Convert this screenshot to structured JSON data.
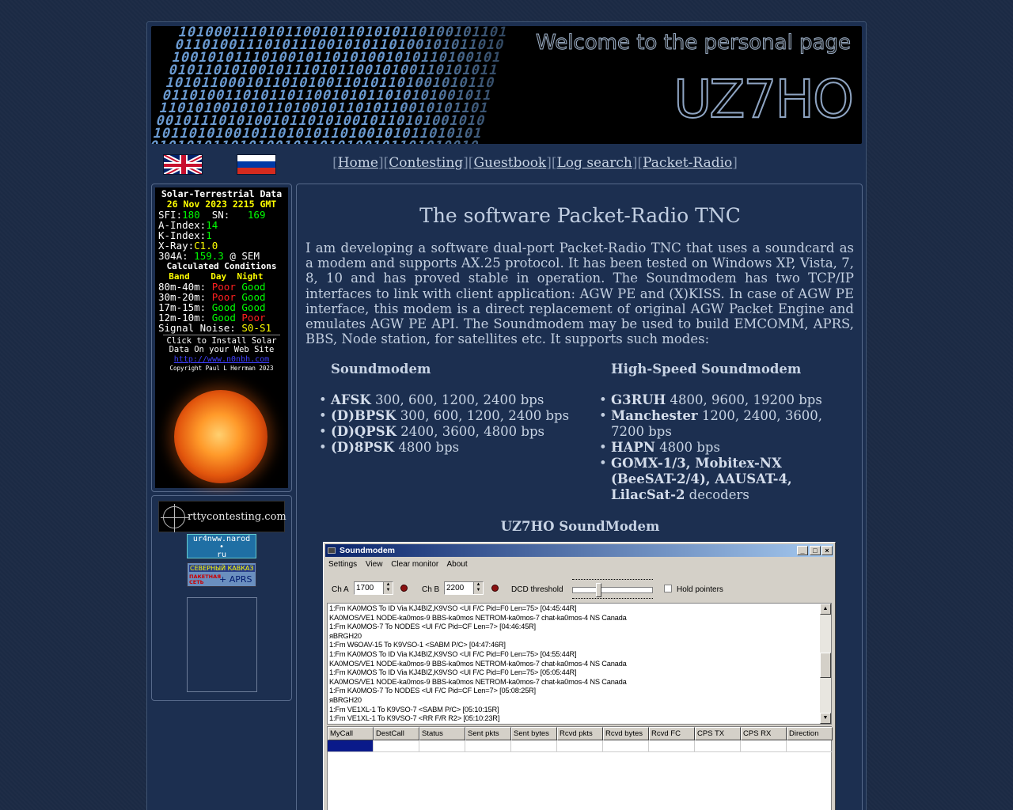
{
  "banner": {
    "welcome": "Welcome to the personal page",
    "callsign": "UZ7HO"
  },
  "nav": {
    "items": [
      "Home",
      "Contesting",
      "Guestbook",
      "Log search",
      "Packet-Radio"
    ]
  },
  "solar": {
    "title": "Solar-Terrestrial Data",
    "date": "26 Nov 2023 2215 GMT",
    "sfi_label": "SFI:",
    "sfi": "180",
    "sn_label": "SN:",
    "sn": "169",
    "aindex_label": "A-Index:",
    "aindex": "14",
    "kindex_label": "K-Index:",
    "kindex": "1",
    "xray_label": "X-Ray:",
    "xray": "C1.0",
    "a304_label": "304A:",
    "a304": "159.3",
    "a304_suffix": "@ SEM",
    "conditions_title": "Calculated Conditions",
    "col_band": "Band",
    "col_day": "Day",
    "col_night": "Night",
    "bands": [
      {
        "band": "80m-40m:",
        "day": "Poor",
        "night": "Good"
      },
      {
        "band": "30m-20m:",
        "day": "Poor",
        "night": "Good"
      },
      {
        "band": "17m-15m:",
        "day": "Good",
        "night": "Good"
      },
      {
        "band": "12m-10m:",
        "day": "Good",
        "night": "Poor"
      }
    ],
    "noise_label": "Signal Noise:",
    "noise": "S0-S1",
    "install1": "Click to Install Solar",
    "install2": "Data On your Web Site",
    "link": "http://www.n0nbh.com",
    "copyright": "Copyright Paul L Herrman 2023"
  },
  "links": {
    "rtty": "rttycontesting.com",
    "narod_line1": "ur4nww.narod",
    "narod_line2": "ru",
    "kavkaz_title": "СЕВЕРНЫЙ КАВКАЗ",
    "kavkaz_sub1": "ПАКЕТНАЯ",
    "kavkaz_sub2": "СЕТЬ",
    "kavkaz_aprs": "+ APRS"
  },
  "content": {
    "title": "The software Packet-Radio TNC",
    "intro": "I am developing a software dual-port Packet-Radio TNC that uses a soundcard as a modem and supports AX.25 protocol. It has been tested on Windows XP, Vista, 7, 8, 10 and has proved stable in operation. The Soundmodem has two TCP/IP interfaces to link with client application: AGW PE and (X)KISS. In case of AGW PE interface, this modem is a direct replacement of original AGW Packet Engine and emulates AGW PE API. The Soundmodem may be used to build EMCOMM, APRS, BBS, Node station, for satellites etc. It supports such modes:",
    "col1_title": "Soundmodem",
    "col1_items": [
      {
        "mode": "AFSK",
        "rates": " 300, 600, 1200, 2400 bps"
      },
      {
        "mode": "(D)BPSK",
        "rates": " 300, 600, 1200, 2400 bps"
      },
      {
        "mode": "(D)QPSK",
        "rates": " 2400, 3600, 4800 bps"
      },
      {
        "mode": "(D)8PSK",
        "rates": " 4800 bps"
      }
    ],
    "col2_title": "High-Speed Soundmodem",
    "col2_items": [
      {
        "mode": "G3RUH",
        "rates": " 4800, 9600, 19200 bps"
      },
      {
        "mode": "Manchester",
        "rates": " 1200, 2400, 3600, 7200 bps"
      },
      {
        "mode": "HAPN",
        "rates": " 4800 bps"
      },
      {
        "mode": "GOMX-1/3, Mobitex-NX (BeeSAT-2/4), AAUSAT-4, LilacSat-2",
        "rates": " decoders"
      }
    ],
    "screenshot_title": "UZ7HO SoundModem"
  },
  "window": {
    "title": "Soundmodem",
    "menu": [
      "Settings",
      "View",
      "Clear monitor",
      "About"
    ],
    "cha_label": "Ch A",
    "cha_value": "1700",
    "chb_label": "Ch B",
    "chb_value": "2200",
    "dcd_label": "DCD threshold",
    "hold_label": "Hold pointers",
    "monitor_lines": [
      "1:Fm KA0MOS To ID Via KJ4BIZ,K9VSO <UI F/C Pid=F0 Len=75> [04:45:44R]",
      "KA0MOS/VE1 NODE-ka0mos-9 BBS-ka0mos NETROM-ka0mos-7 chat-ka0mos-4 NS Canada",
      "1:Fm KA0MOS-7 To NODES <UI F/C Pid=CF Len=7> [04:46:45R]",
      "яBRGH20",
      "1:Fm W6OAV-15 To K9VSO-1 <SABM P/C> [04:47:46R]",
      "1:Fm KA0MOS To ID Via KJ4BIZ,K9VSO <UI F/C Pid=F0 Len=75> [04:55:44R]",
      "KA0MOS/VE1 NODE-ka0mos-9 BBS-ka0mos NETROM-ka0mos-7 chat-ka0mos-4 NS Canada",
      "1:Fm KA0MOS To ID Via KJ4BIZ,K9VSO <UI F/C Pid=F0 Len=75> [05:05:44R]",
      "KA0MOS/VE1 NODE-ka0mos-9 BBS-ka0mos NETROM-ka0mos-7 chat-ka0mos-4 NS Canada",
      "1:Fm KA0MOS-7 To NODES <UI F/C Pid=CF Len=7> [05:08:25R]",
      "яBRGH20",
      "1:Fm VE1XL-1 To K9VSO-7 <SABM P/C> [05:10:15R]",
      "1:Fm VE1XL-1 To K9VSO-7 <RR F/R R2> [05:10:23R]"
    ],
    "columns": [
      "MyCall",
      "DestCall",
      "Status",
      "Sent pkts",
      "Sent bytes",
      "Rcvd pkts",
      "Rcvd bytes",
      "Rcvd FC",
      "CPS TX",
      "CPS RX",
      "Direction"
    ]
  }
}
